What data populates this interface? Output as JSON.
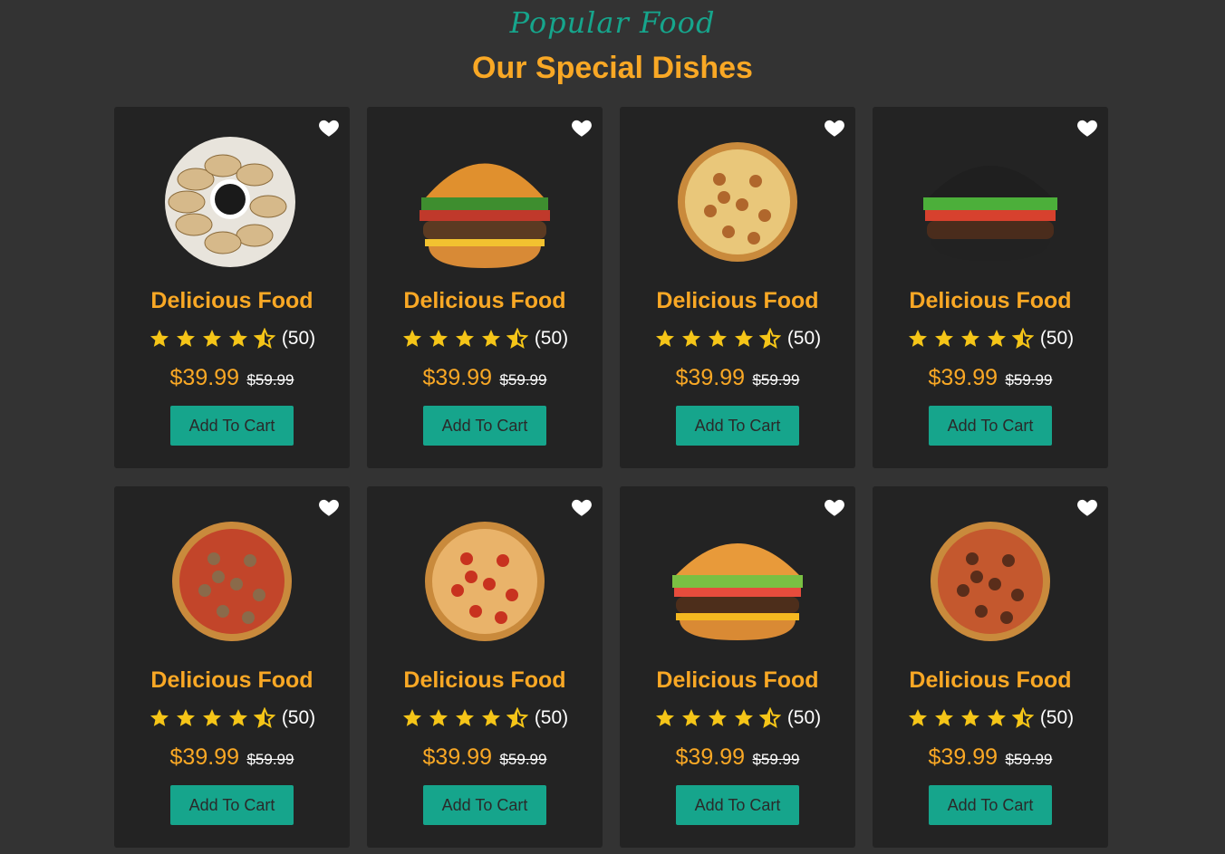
{
  "section": {
    "subtitle": "Popular Food",
    "title": "Our Special Dishes"
  },
  "colors": {
    "accent_orange": "#f9a825",
    "accent_teal": "#16a58c",
    "card_bg": "#232323",
    "page_bg": "#333333"
  },
  "dishes": [
    {
      "name": "Delicious Food",
      "rating": 4.5,
      "reviews": "(50)",
      "price": "$39.99",
      "old_price": "$59.99",
      "button": "Add To Cart",
      "image": "dumplings"
    },
    {
      "name": "Delicious Food",
      "rating": 4.5,
      "reviews": "(50)",
      "price": "$39.99",
      "old_price": "$59.99",
      "button": "Add To Cart",
      "image": "burger"
    },
    {
      "name": "Delicious Food",
      "rating": 4.5,
      "reviews": "(50)",
      "price": "$39.99",
      "old_price": "$59.99",
      "button": "Add To Cart",
      "image": "pizza-cheese"
    },
    {
      "name": "Delicious Food",
      "rating": 4.5,
      "reviews": "(50)",
      "price": "$39.99",
      "old_price": "$59.99",
      "button": "Add To Cart",
      "image": "black-burger"
    },
    {
      "name": "Delicious Food",
      "rating": 4.5,
      "reviews": "(50)",
      "price": "$39.99",
      "old_price": "$59.99",
      "button": "Add To Cart",
      "image": "pizza-mushroom"
    },
    {
      "name": "Delicious Food",
      "rating": 4.5,
      "reviews": "(50)",
      "price": "$39.99",
      "old_price": "$59.99",
      "button": "Add To Cart",
      "image": "pizza-pepperoni"
    },
    {
      "name": "Delicious Food",
      "rating": 4.5,
      "reviews": "(50)",
      "price": "$39.99",
      "old_price": "$59.99",
      "button": "Add To Cart",
      "image": "cheeseburger"
    },
    {
      "name": "Delicious Food",
      "rating": 4.5,
      "reviews": "(50)",
      "price": "$39.99",
      "old_price": "$59.99",
      "button": "Add To Cart",
      "image": "pizza-sausage"
    }
  ]
}
